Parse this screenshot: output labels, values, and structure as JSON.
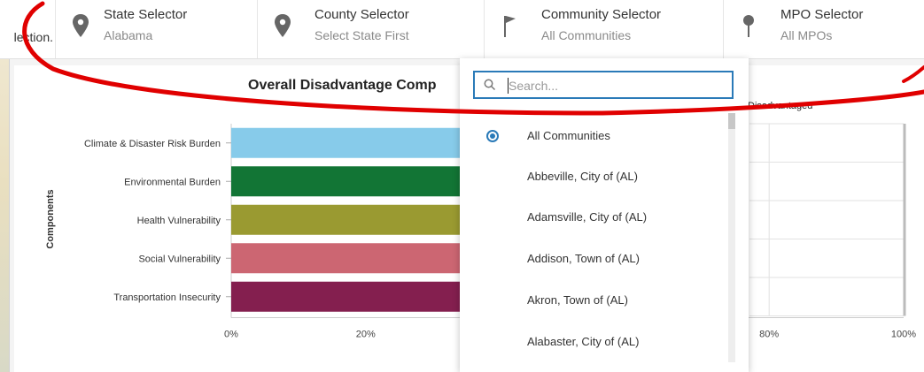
{
  "left_cut_text": "lection.",
  "header": {
    "selectors": [
      {
        "title": "State Selector",
        "value": "Alabama",
        "icon": "map-pin-icon"
      },
      {
        "title": "County Selector",
        "value": "Select State First",
        "icon": "map-pin-icon"
      },
      {
        "title": "Community Selector",
        "value": "All Communities",
        "icon": "flag-icon"
      },
      {
        "title": "MPO Selector",
        "value": "All MPOs",
        "icon": "pin-icon"
      }
    ]
  },
  "chart_data": {
    "type": "bar",
    "orientation": "horizontal",
    "title": "Overall Disadvantage Comp",
    "legend_partial": "Disadvantaged",
    "ylabel": "Components",
    "categories": [
      "Climate & Disaster Risk Burden",
      "Environmental Burden",
      "Health Vulnerability",
      "Social Vulnerability",
      "Transportation Insecurity"
    ],
    "colors": [
      "#87cbea",
      "#127535",
      "#9a9a31",
      "#cc6672",
      "#841f4f"
    ],
    "x_ticks": [
      "0%",
      "20%",
      "80%",
      "100%"
    ],
    "grid": true
  },
  "dropdown": {
    "search_placeholder": "Search...",
    "options": [
      {
        "label": "All Communities",
        "selected": true
      },
      {
        "label": "Abbeville, City of (AL)",
        "selected": false
      },
      {
        "label": "Adamsville, City of (AL)",
        "selected": false
      },
      {
        "label": "Addison, Town of (AL)",
        "selected": false
      },
      {
        "label": "Akron, Town of (AL)",
        "selected": false
      },
      {
        "label": "Alabaster, City of (AL)",
        "selected": false
      }
    ]
  },
  "colors": {
    "accent": "#2a7ab8",
    "annotation": "#e00000"
  }
}
